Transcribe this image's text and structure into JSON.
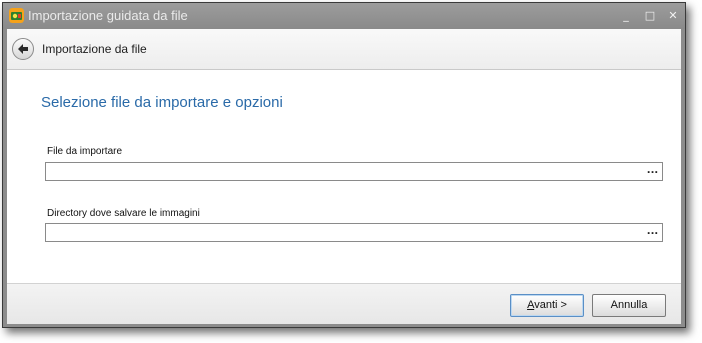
{
  "window": {
    "title": "Importazione guidata da file",
    "controls": {
      "minimize": "_",
      "maximize": "□",
      "close": "✕"
    }
  },
  "nav": {
    "title": "Importazione da file",
    "back_icon": "back-arrow-icon"
  },
  "main": {
    "heading": "Selezione file da importare e opzioni",
    "fields": [
      {
        "label": "File da importare",
        "value": "",
        "button": "..."
      },
      {
        "label": "Directory dove salvare le immagini",
        "value": "",
        "button": "..."
      }
    ]
  },
  "footer": {
    "next_label_mnemonic": "A",
    "next_label_rest": "vanti >",
    "cancel_label": "Annulla"
  },
  "colors": {
    "heading": "#2a6aa8",
    "titlebar": "#8c8c8c",
    "default_button_border": "#5a8fc6"
  }
}
